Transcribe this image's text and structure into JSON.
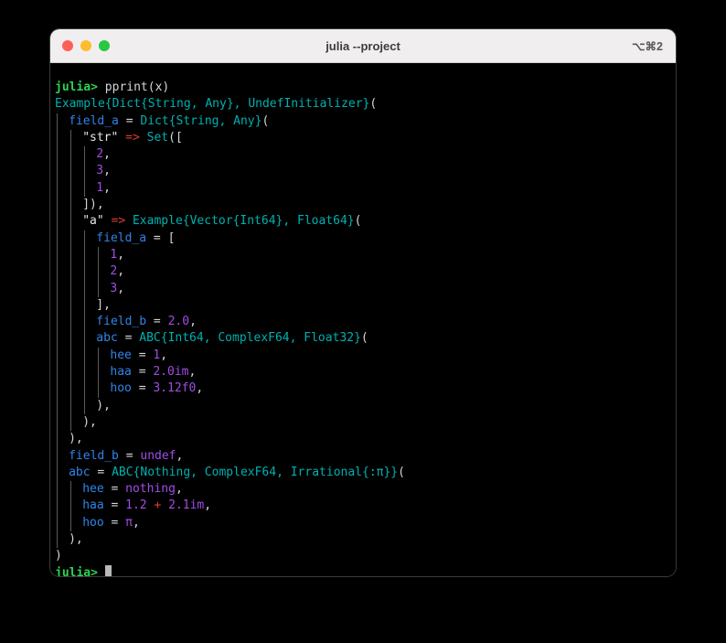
{
  "window": {
    "title": "julia --project",
    "shortcut_hint": "⌥⌘2",
    "traffic_lights": [
      {
        "name": "close",
        "color": "#ff5f57"
      },
      {
        "name": "minimize",
        "color": "#febc2e"
      },
      {
        "name": "maximize",
        "color": "#28c840"
      }
    ]
  },
  "theme": {
    "background": "#000000",
    "titlebar_background": "#f0eeee",
    "titlebar_text": "#3d3d3d",
    "foreground": "#d6d6d6",
    "prompt_green": "#2fd14f",
    "type_cyan": "#00b0b0",
    "field_blue": "#2f85e8",
    "number_purple": "#a24ce6",
    "operator_red": "#e43b2e",
    "indent_guide": "#5a5a5a",
    "cursor": "#b9b9b9"
  },
  "terminal": {
    "char_width": 7.55,
    "line_height": 18.3,
    "cursor_visible": true,
    "lines": [
      {
        "indent": 0,
        "tokens": [
          {
            "t": "prompt",
            "s": "julia>"
          },
          {
            "t": "plain",
            "s": " pprint(x)"
          }
        ]
      },
      {
        "indent": 0,
        "tokens": [
          {
            "t": "type",
            "s": "Example{Dict{String, Any}, UndefInitializer}"
          },
          {
            "t": "punct",
            "s": "("
          }
        ]
      },
      {
        "indent": 1,
        "tokens": [
          {
            "t": "field",
            "s": "field_a"
          },
          {
            "t": "plain",
            "s": " = "
          },
          {
            "t": "type",
            "s": "Dict{String, Any}"
          },
          {
            "t": "punct",
            "s": "("
          }
        ]
      },
      {
        "indent": 2,
        "tokens": [
          {
            "t": "str",
            "s": "\"str\""
          },
          {
            "t": "plain",
            "s": " "
          },
          {
            "t": "op",
            "s": "=>"
          },
          {
            "t": "plain",
            "s": " "
          },
          {
            "t": "type",
            "s": "Set"
          },
          {
            "t": "punct",
            "s": "(["
          }
        ]
      },
      {
        "indent": 3,
        "tokens": [
          {
            "t": "num",
            "s": "2"
          },
          {
            "t": "punct",
            "s": ","
          }
        ]
      },
      {
        "indent": 3,
        "tokens": [
          {
            "t": "num",
            "s": "3"
          },
          {
            "t": "punct",
            "s": ","
          }
        ]
      },
      {
        "indent": 3,
        "tokens": [
          {
            "t": "num",
            "s": "1"
          },
          {
            "t": "punct",
            "s": ","
          }
        ]
      },
      {
        "indent": 2,
        "tokens": [
          {
            "t": "punct",
            "s": "]),"
          }
        ]
      },
      {
        "indent": 2,
        "tokens": [
          {
            "t": "str",
            "s": "\"a\""
          },
          {
            "t": "plain",
            "s": " "
          },
          {
            "t": "op",
            "s": "=>"
          },
          {
            "t": "plain",
            "s": " "
          },
          {
            "t": "type",
            "s": "Example{Vector{Int64}, Float64}"
          },
          {
            "t": "punct",
            "s": "("
          }
        ]
      },
      {
        "indent": 3,
        "tokens": [
          {
            "t": "field",
            "s": "field_a"
          },
          {
            "t": "plain",
            "s": " = "
          },
          {
            "t": "punct",
            "s": "["
          }
        ]
      },
      {
        "indent": 4,
        "tokens": [
          {
            "t": "num",
            "s": "1"
          },
          {
            "t": "punct",
            "s": ","
          }
        ]
      },
      {
        "indent": 4,
        "tokens": [
          {
            "t": "num",
            "s": "2"
          },
          {
            "t": "punct",
            "s": ","
          }
        ]
      },
      {
        "indent": 4,
        "tokens": [
          {
            "t": "num",
            "s": "3"
          },
          {
            "t": "punct",
            "s": ","
          }
        ]
      },
      {
        "indent": 3,
        "tokens": [
          {
            "t": "punct",
            "s": "],"
          }
        ]
      },
      {
        "indent": 3,
        "tokens": [
          {
            "t": "field",
            "s": "field_b"
          },
          {
            "t": "plain",
            "s": " = "
          },
          {
            "t": "num",
            "s": "2.0"
          },
          {
            "t": "punct",
            "s": ","
          }
        ]
      },
      {
        "indent": 3,
        "tokens": [
          {
            "t": "field",
            "s": "abc"
          },
          {
            "t": "plain",
            "s": " = "
          },
          {
            "t": "type",
            "s": "ABC{Int64, ComplexF64, Float32}"
          },
          {
            "t": "punct",
            "s": "("
          }
        ]
      },
      {
        "indent": 4,
        "tokens": [
          {
            "t": "field",
            "s": "hee"
          },
          {
            "t": "plain",
            "s": " = "
          },
          {
            "t": "num",
            "s": "1"
          },
          {
            "t": "punct",
            "s": ","
          }
        ]
      },
      {
        "indent": 4,
        "tokens": [
          {
            "t": "field",
            "s": "haa"
          },
          {
            "t": "plain",
            "s": " = "
          },
          {
            "t": "num",
            "s": "2.0im"
          },
          {
            "t": "punct",
            "s": ","
          }
        ]
      },
      {
        "indent": 4,
        "tokens": [
          {
            "t": "field",
            "s": "hoo"
          },
          {
            "t": "plain",
            "s": " = "
          },
          {
            "t": "num",
            "s": "3.12f0"
          },
          {
            "t": "punct",
            "s": ","
          }
        ]
      },
      {
        "indent": 3,
        "tokens": [
          {
            "t": "punct",
            "s": "),"
          }
        ]
      },
      {
        "indent": 2,
        "tokens": [
          {
            "t": "punct",
            "s": "),"
          }
        ]
      },
      {
        "indent": 1,
        "tokens": [
          {
            "t": "punct",
            "s": "),"
          }
        ]
      },
      {
        "indent": 1,
        "tokens": [
          {
            "t": "field",
            "s": "field_b"
          },
          {
            "t": "plain",
            "s": " = "
          },
          {
            "t": "num",
            "s": "undef"
          },
          {
            "t": "punct",
            "s": ","
          }
        ]
      },
      {
        "indent": 1,
        "tokens": [
          {
            "t": "field",
            "s": "abc"
          },
          {
            "t": "plain",
            "s": " = "
          },
          {
            "t": "type",
            "s": "ABC{Nothing, ComplexF64, Irrational{:π}}"
          },
          {
            "t": "punct",
            "s": "("
          }
        ]
      },
      {
        "indent": 2,
        "tokens": [
          {
            "t": "field",
            "s": "hee"
          },
          {
            "t": "plain",
            "s": " = "
          },
          {
            "t": "num",
            "s": "nothing"
          },
          {
            "t": "punct",
            "s": ","
          }
        ]
      },
      {
        "indent": 2,
        "tokens": [
          {
            "t": "field",
            "s": "haa"
          },
          {
            "t": "plain",
            "s": " = "
          },
          {
            "t": "num",
            "s": "1.2"
          },
          {
            "t": "plain",
            "s": " "
          },
          {
            "t": "op",
            "s": "+"
          },
          {
            "t": "plain",
            "s": " "
          },
          {
            "t": "num",
            "s": "2.1im"
          },
          {
            "t": "punct",
            "s": ","
          }
        ]
      },
      {
        "indent": 2,
        "tokens": [
          {
            "t": "field",
            "s": "hoo"
          },
          {
            "t": "plain",
            "s": " = "
          },
          {
            "t": "num",
            "s": "π"
          },
          {
            "t": "punct",
            "s": ","
          }
        ]
      },
      {
        "indent": 1,
        "tokens": [
          {
            "t": "punct",
            "s": "),"
          }
        ]
      },
      {
        "indent": 0,
        "tokens": [
          {
            "t": "punct",
            "s": ")"
          }
        ]
      },
      {
        "indent": 0,
        "prompt_line": true,
        "tokens": [
          {
            "t": "prompt",
            "s": "julia>"
          },
          {
            "t": "plain",
            "s": " "
          }
        ]
      }
    ]
  }
}
